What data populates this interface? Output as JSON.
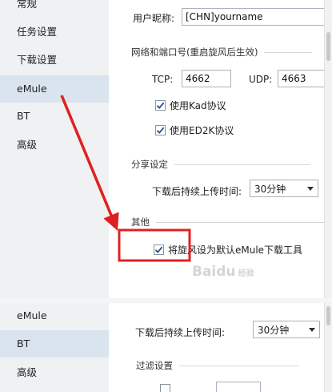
{
  "sidebar_top": {
    "items": [
      {
        "label": "常规",
        "active": false
      },
      {
        "label": "任务设置",
        "active": false
      },
      {
        "label": "下载设置",
        "active": false
      },
      {
        "label": "eMule",
        "active": true
      },
      {
        "label": "BT",
        "active": false
      },
      {
        "label": "高级",
        "active": false
      }
    ]
  },
  "emule": {
    "nickname_label": "用户昵称:",
    "nickname_value": "[CHN]yourname",
    "network_title": "网络和端口号(重启旋风后生效)",
    "tcp_label": "TCP:",
    "tcp_value": "4662",
    "udp_label": "UDP:",
    "udp_value": "4663",
    "use_kad_label": "使用Kad协议",
    "use_kad_checked": true,
    "use_ed2k_label": "使用ED2K协议",
    "use_ed2k_checked": true,
    "share_title": "分享设定",
    "upload_after_label": "下载后持续上传时间:",
    "upload_after_value": "30分钟",
    "other_title": "其他",
    "default_tool_label": "将旋风设为默认eMule下载工具",
    "default_tool_checked": true
  },
  "sidebar_bottom": {
    "items": [
      {
        "label": "eMule",
        "active": false
      },
      {
        "label": "BT",
        "active": true
      },
      {
        "label": "高级",
        "active": false
      }
    ]
  },
  "bt": {
    "upload_after_label": "下载后持续上传时间:",
    "upload_after_value": "30分钟",
    "filter_title": "过滤设置"
  },
  "annotation": {
    "color": "#e02020"
  },
  "watermark": {
    "text": "Baidu",
    "sub": "经验"
  }
}
